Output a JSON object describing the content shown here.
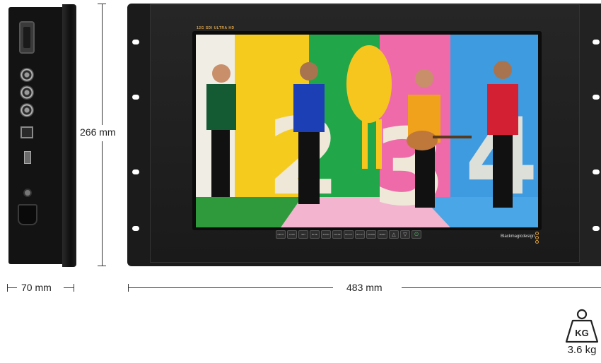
{
  "side_view": {
    "depth_label": "70 mm",
    "ports": [
      "db9-connector",
      "sdi-bnc-1",
      "sdi-bnc-2",
      "sdi-bnc-3",
      "ethernet-port",
      "usb-port",
      "power-jack",
      "iec-power-inlet"
    ]
  },
  "front_view": {
    "height_label": "266 mm",
    "width_label": "483 mm",
    "screen_badge": "12G SDI  ULTRA HD",
    "brand": "Blackmagicdesign",
    "control_buttons": [
      "INPUT",
      "LOOK",
      "SET DELAY",
      "BLUE ONLY",
      "ZOOM",
      "FALSE",
      "3D LUT 1",
      "3D LUT 2",
      "SCOPE",
      "MARK",
      "△",
      "▽",
      "⏻"
    ]
  },
  "weight": {
    "icon": "kg-weight-icon",
    "icon_text": "KG",
    "value": "3.6 kg"
  },
  "colors": {
    "accent": "#e3a23a",
    "chassis": "#1b1b1b"
  }
}
